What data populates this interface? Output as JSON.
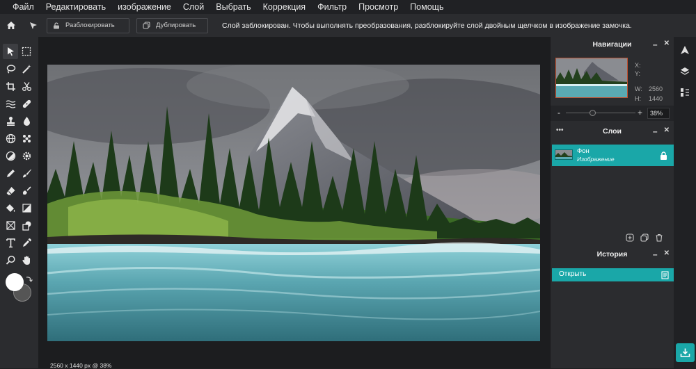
{
  "menu": [
    "Файл",
    "Редактировать",
    "изображение",
    "Слой",
    "Выбрать",
    "Коррекция",
    "Фильтр",
    "Просмотр",
    "Помощь"
  ],
  "options": {
    "unlock_label": "Разблокировать",
    "duplicate_label": "Дублировать",
    "message": "Слой заблокирован. Чтобы выполнять преобразования, разблокируйте слой двойным щелчком в изображение замочка."
  },
  "status": "2560 x 1440 px @ 38%",
  "navigator": {
    "title": "Навигации",
    "x_label": "X:",
    "y_label": "Y:",
    "w_label": "W:",
    "h_label": "H:",
    "w_value": "2560",
    "h_value": "1440",
    "zoom_minus": "-",
    "zoom_plus": "+",
    "zoom_value": "38%",
    "zoom_level": 0.38
  },
  "layers": {
    "title": "Слои",
    "dots": "•••",
    "items": [
      {
        "name": "Фон",
        "subtitle": "Изображение"
      }
    ]
  },
  "history": {
    "title": "История",
    "items": [
      "Открыть"
    ]
  },
  "panel_controls": {
    "minimize": "–",
    "close": "✕"
  },
  "colors": {
    "accent": "#1aa7a8",
    "foreground": "#ffffff",
    "background": "#555555"
  }
}
